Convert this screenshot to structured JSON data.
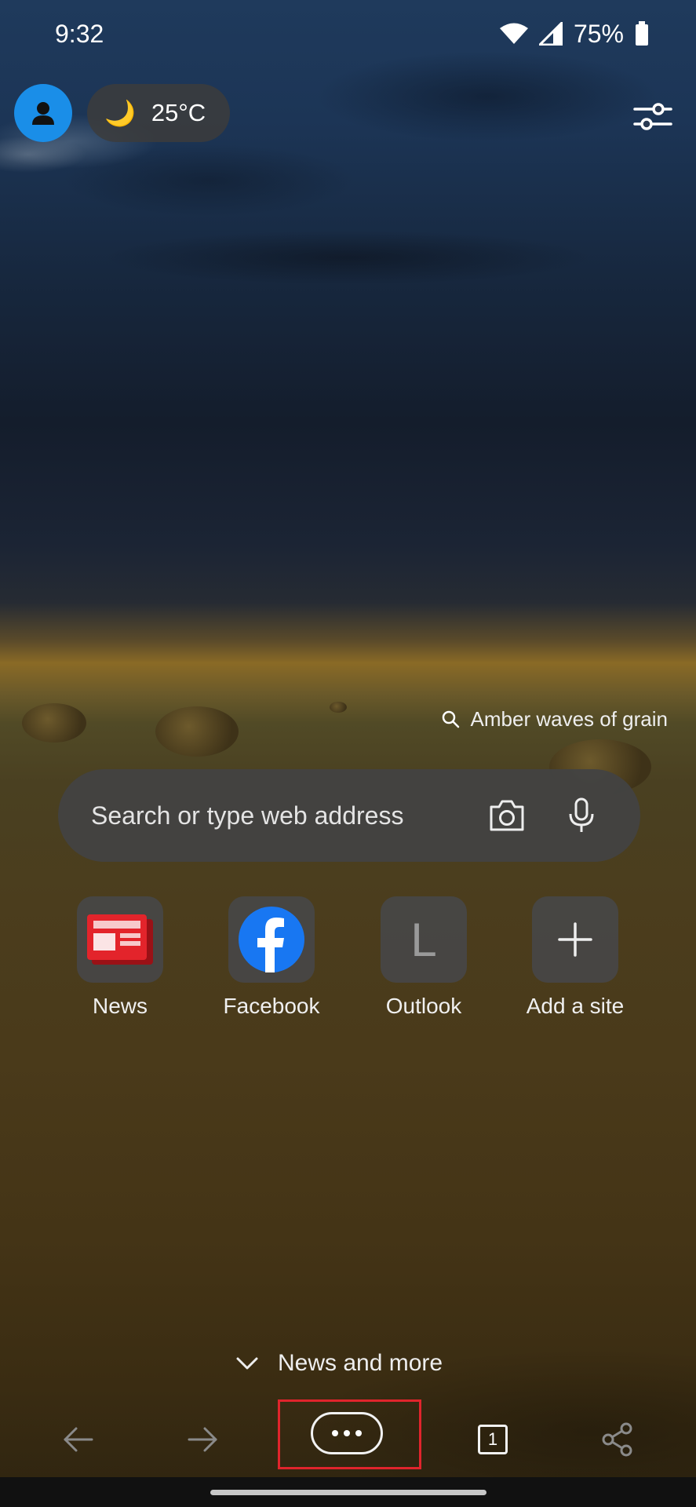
{
  "status_bar": {
    "time": "9:32",
    "battery": "75%",
    "icons": [
      "wifi-icon",
      "signal-icon",
      "battery-icon"
    ]
  },
  "top_bar": {
    "avatar_icon": "person-icon",
    "weather": {
      "icon": "moon-icon",
      "temperature": "25°C"
    },
    "customize_icon": "sliders-icon"
  },
  "background": {
    "caption": "Amber waves of grain",
    "caption_icon": "search-icon"
  },
  "search": {
    "placeholder": "Search or type web address",
    "camera_icon": "camera-icon",
    "mic_icon": "microphone-icon"
  },
  "quick_links": [
    {
      "label": "News",
      "icon": "news-icon",
      "icon_color": "#e3242b"
    },
    {
      "label": "Facebook",
      "icon": "facebook-icon",
      "icon_color": "#1877f2"
    },
    {
      "label": "Outlook",
      "icon": "letter-l-icon",
      "letter": "L"
    },
    {
      "label": "Add a site",
      "icon": "plus-icon"
    }
  ],
  "feed": {
    "label": "News and more",
    "icon": "chevron-down-icon"
  },
  "toolbar": {
    "back_icon": "arrow-left-icon",
    "forward_icon": "arrow-right-icon",
    "more_icon": "more-icon",
    "tabs_count": "1",
    "share_icon": "share-icon",
    "highlight_color": "#e0242c"
  }
}
